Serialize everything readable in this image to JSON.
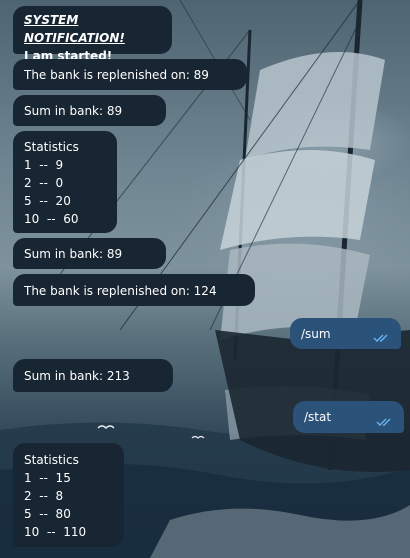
{
  "messages": {
    "m1": {
      "title": "SYSTEM NOTIFICATION!",
      "line": "I am started!"
    },
    "m2": {
      "text": "The bank is replenished on: 89"
    },
    "m3": {
      "text": "Sum in bank:  89"
    },
    "m4": {
      "title": "Statistics",
      "rows": [
        "1  --  9",
        "2  --  0",
        "5  --  20",
        "10  --  60"
      ]
    },
    "m5": {
      "text": "Sum in bank:  89"
    },
    "m6": {
      "text": "The bank is replenished on: 124"
    },
    "m7": {
      "text": "/sum",
      "status_icon": "double-check-icon"
    },
    "m8": {
      "text": "Sum in bank:  213"
    },
    "m9": {
      "text": "/stat",
      "status_icon": "double-check-icon"
    },
    "m10": {
      "title": "Statistics",
      "rows": [
        "1  --  15",
        "2  --  8",
        "5  --  80",
        "10  --  110"
      ]
    }
  },
  "colors": {
    "incoming_bubble": "#182533",
    "outgoing_bubble": "#2b5278",
    "read_ticks": "#6ab3f3"
  }
}
